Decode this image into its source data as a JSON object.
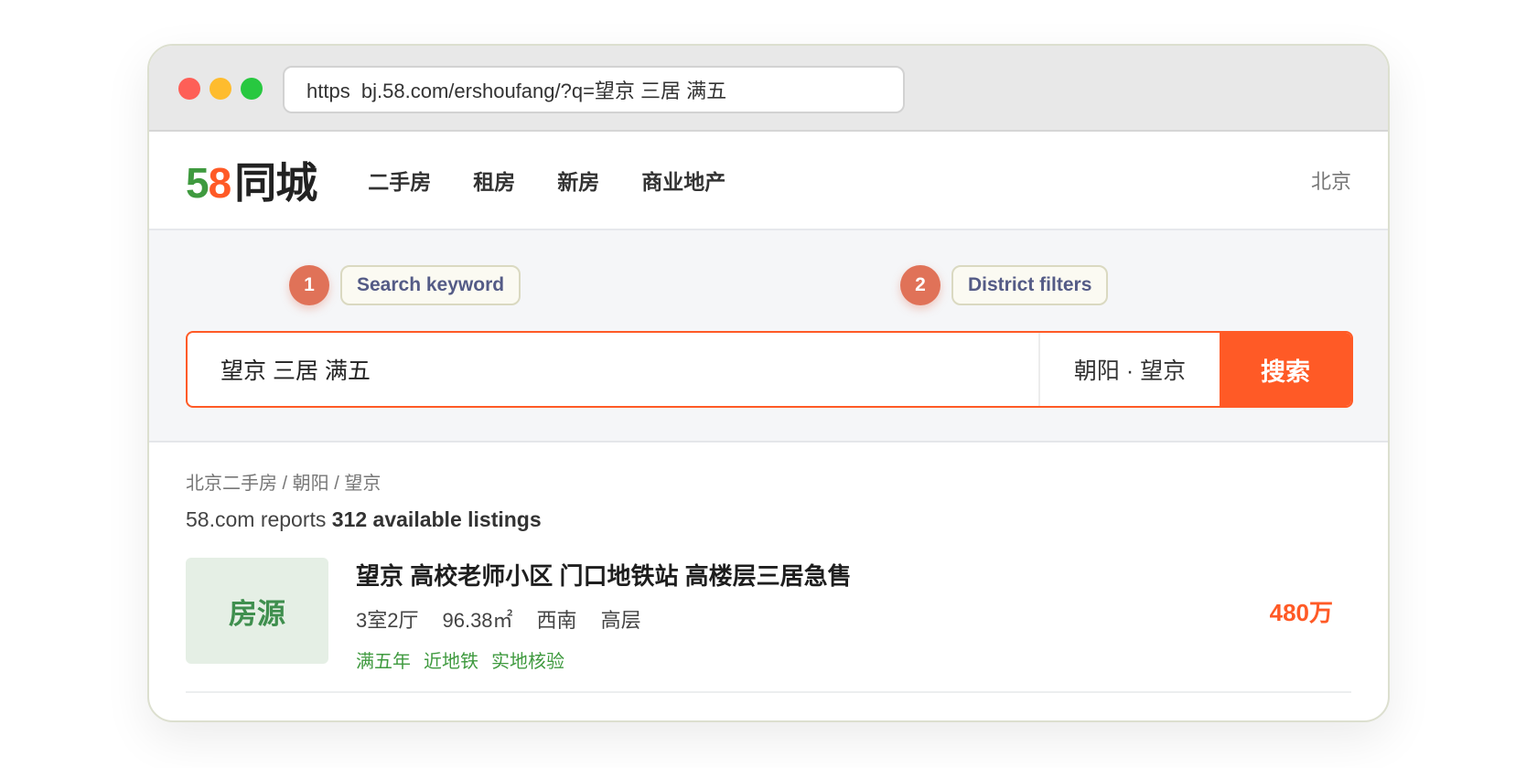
{
  "browser": {
    "url": "https  bj.58.com/ershoufang/?q=望京 三居 满五"
  },
  "site": {
    "logo_5": "5",
    "logo_8": "8",
    "logo_text": "同城",
    "nav": [
      "二手房",
      "租房",
      "新房",
      "商业地产"
    ],
    "city": "北京"
  },
  "callouts": [
    {
      "num": "1",
      "label": "Search keyword"
    },
    {
      "num": "2",
      "label": "District filters"
    }
  ],
  "search": {
    "keyword": "望京 三居 满五",
    "district": "朝阳 · 望京",
    "button": "搜索"
  },
  "results": {
    "breadcrumb": "北京二手房 / 朝阳 / 望京",
    "count_prefix": "58.com reports ",
    "count_bold": "312 available listings",
    "listing": {
      "thumb": "房源",
      "title": "望京 高校老师小区 门口地铁站 高楼层三居急售",
      "attrs": [
        "3室2厅",
        "96.38㎡",
        "西南",
        "高层"
      ],
      "tags": [
        "满五年",
        "近地铁",
        "实地核验"
      ],
      "price": "480万"
    }
  },
  "colors": {
    "brand_orange": "#ff5a26",
    "brand_green": "#3f9a3f",
    "callout": "#e07258"
  }
}
